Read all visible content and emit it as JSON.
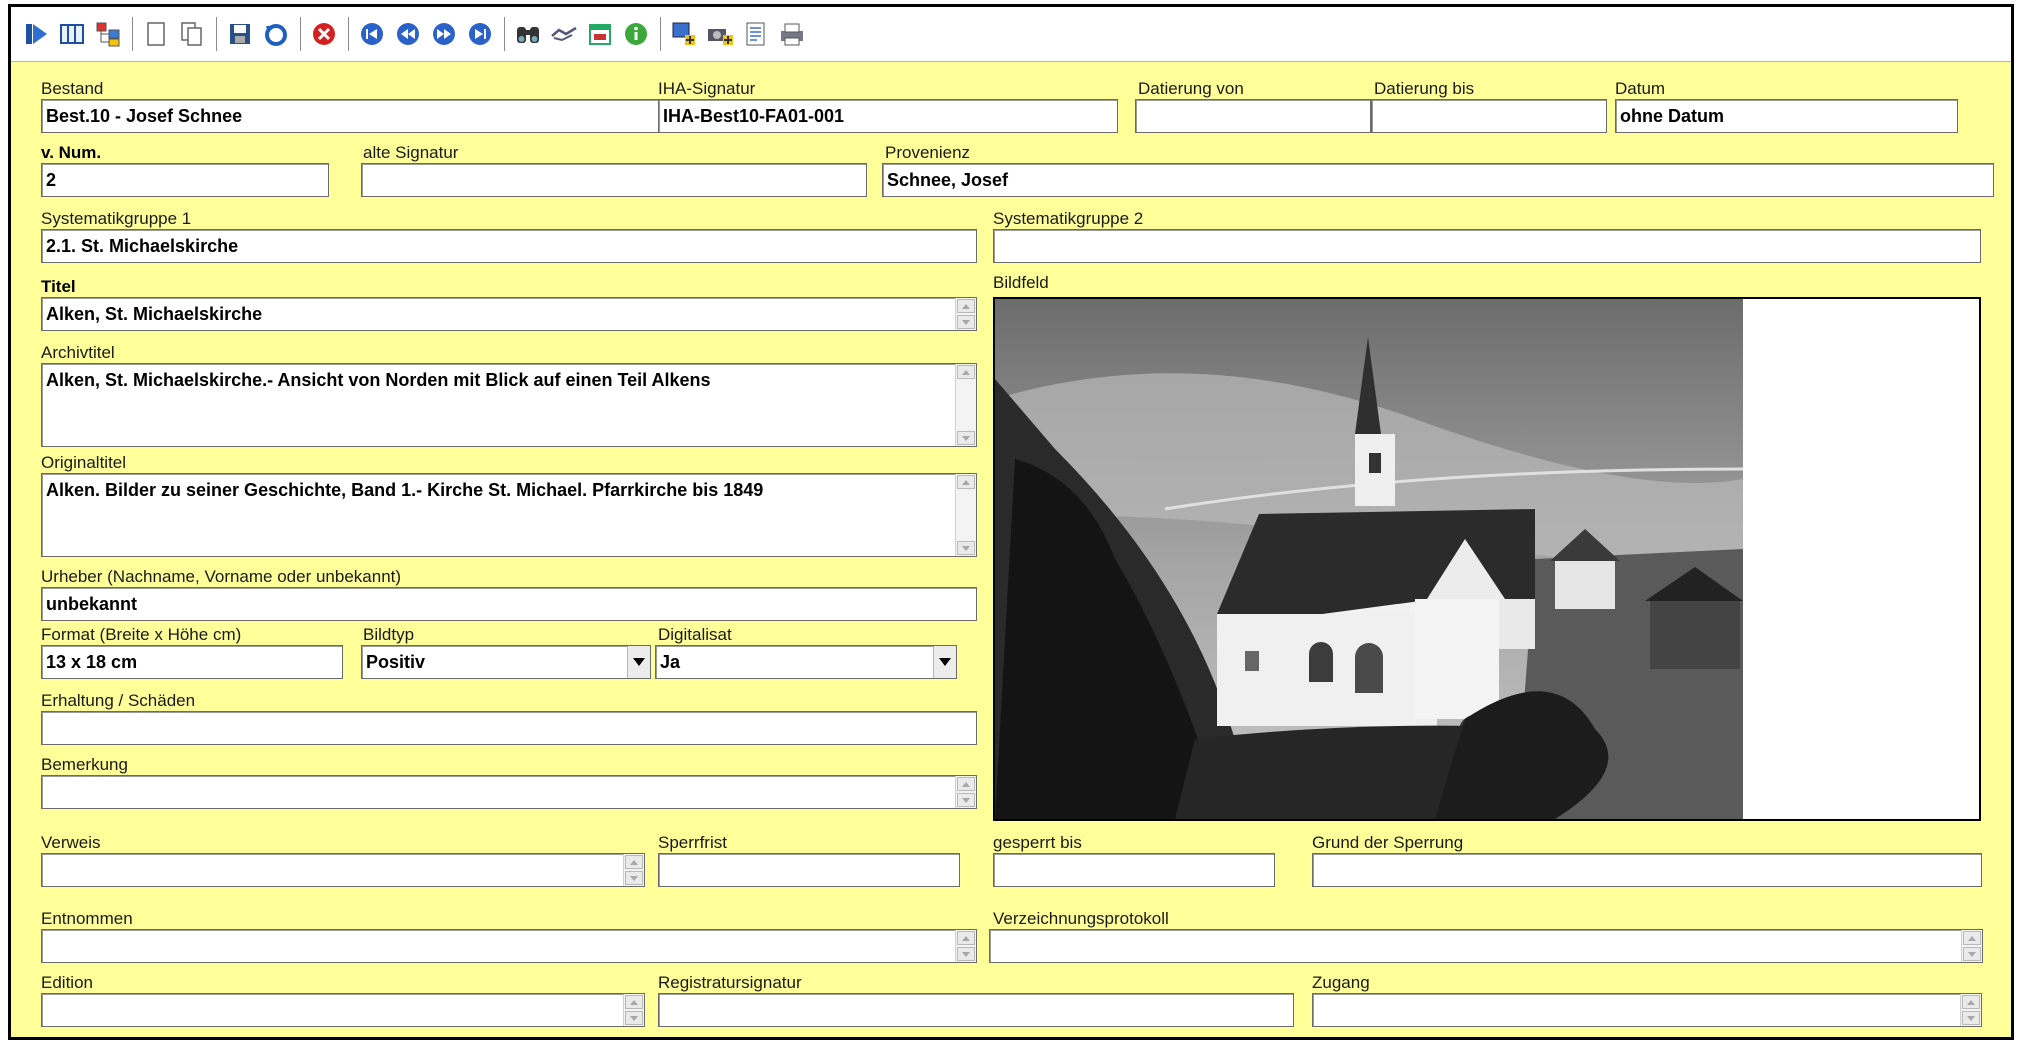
{
  "toolbar": {
    "icons": [
      "exit-icon",
      "grid-view-icon",
      "tree-view-icon",
      "new-record-icon",
      "copy-record-icon",
      "save-icon",
      "undo-icon",
      "delete-icon",
      "first-record-icon",
      "previous-record-icon",
      "next-record-icon",
      "last-record-icon",
      "search-icon",
      "handshake-icon",
      "calendar-icon",
      "info-icon",
      "add-image-icon",
      "add-camera-icon",
      "report-icon",
      "print-icon"
    ]
  },
  "form": {
    "bestand": {
      "label": "Bestand",
      "value": "Best.10 - Josef Schnee"
    },
    "iha_signatur": {
      "label": "IHA-Signatur",
      "value": "IHA-Best10-FA01-001"
    },
    "datierung_von": {
      "label": "Datierung von",
      "value": ""
    },
    "datierung_bis": {
      "label": "Datierung bis",
      "value": ""
    },
    "datum": {
      "label": "Datum",
      "value": "ohne Datum"
    },
    "v_num": {
      "label": "v. Num.",
      "value": "2"
    },
    "alte_signatur": {
      "label": "alte Signatur",
      "value": ""
    },
    "provenienz": {
      "label": "Provenienz",
      "value": "Schnee, Josef"
    },
    "systematik1": {
      "label": "Systematikgruppe 1",
      "value": "2.1. St. Michaelskirche"
    },
    "systematik2": {
      "label": "Systematikgruppe 2",
      "value": ""
    },
    "titel": {
      "label": "Titel",
      "value": "Alken, St. Michaelskirche"
    },
    "archivtitel": {
      "label": "Archivtitel",
      "value": "Alken, St. Michaelskirche.- Ansicht von Norden mit Blick auf einen Teil Alkens"
    },
    "originaltitel": {
      "label": "Originaltitel",
      "value": "Alken. Bilder zu seiner Geschichte, Band 1.- Kirche St. Michael. Pfarrkirche bis 1849"
    },
    "urheber": {
      "label": "Urheber (Nachname, Vorname oder unbekannt)",
      "value": "unbekannt"
    },
    "format": {
      "label": "Format (Breite x Höhe cm)",
      "value": "13 x 18 cm"
    },
    "bildtyp": {
      "label": "Bildtyp",
      "value": "Positiv"
    },
    "digitalisat": {
      "label": "Digitalisat",
      "value": "Ja"
    },
    "erhaltung": {
      "label": "Erhaltung / Schäden",
      "value": ""
    },
    "bemerkung": {
      "label": "Bemerkung",
      "value": ""
    },
    "bildfeld": {
      "label": "Bildfeld"
    },
    "verweis": {
      "label": "Verweis",
      "value": ""
    },
    "sperrfrist": {
      "label": "Sperrfrist",
      "value": ""
    },
    "gesperrt_bis": {
      "label": "gesperrt bis",
      "value": ""
    },
    "grund_sperrung": {
      "label": "Grund der Sperrung",
      "value": ""
    },
    "entnommen": {
      "label": "Entnommen",
      "value": ""
    },
    "verzeichnungsprotokoll": {
      "label": "Verzeichnungsprotokoll",
      "value": ""
    },
    "edition": {
      "label": "Edition",
      "value": ""
    },
    "registratursignatur": {
      "label": "Registratursignatur",
      "value": ""
    },
    "zugang": {
      "label": "Zugang",
      "value": ""
    }
  },
  "colors": {
    "form_background": "#ffff99",
    "field_background": "#ffffff"
  }
}
